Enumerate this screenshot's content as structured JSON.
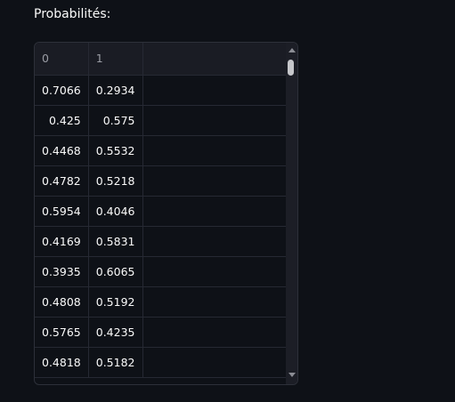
{
  "label": "Probabilités:",
  "table": {
    "columns": [
      "0",
      "1"
    ],
    "rows": [
      [
        "0.7066",
        "0.2934"
      ],
      [
        "0.425",
        "0.575"
      ],
      [
        "0.4468",
        "0.5532"
      ],
      [
        "0.4782",
        "0.5218"
      ],
      [
        "0.5954",
        "0.4046"
      ],
      [
        "0.4169",
        "0.5831"
      ],
      [
        "0.3935",
        "0.6065"
      ],
      [
        "0.4808",
        "0.5192"
      ],
      [
        "0.5765",
        "0.4235"
      ],
      [
        "0.4818",
        "0.5182"
      ]
    ]
  },
  "scrollbar": {
    "position_fraction": 0.0
  }
}
